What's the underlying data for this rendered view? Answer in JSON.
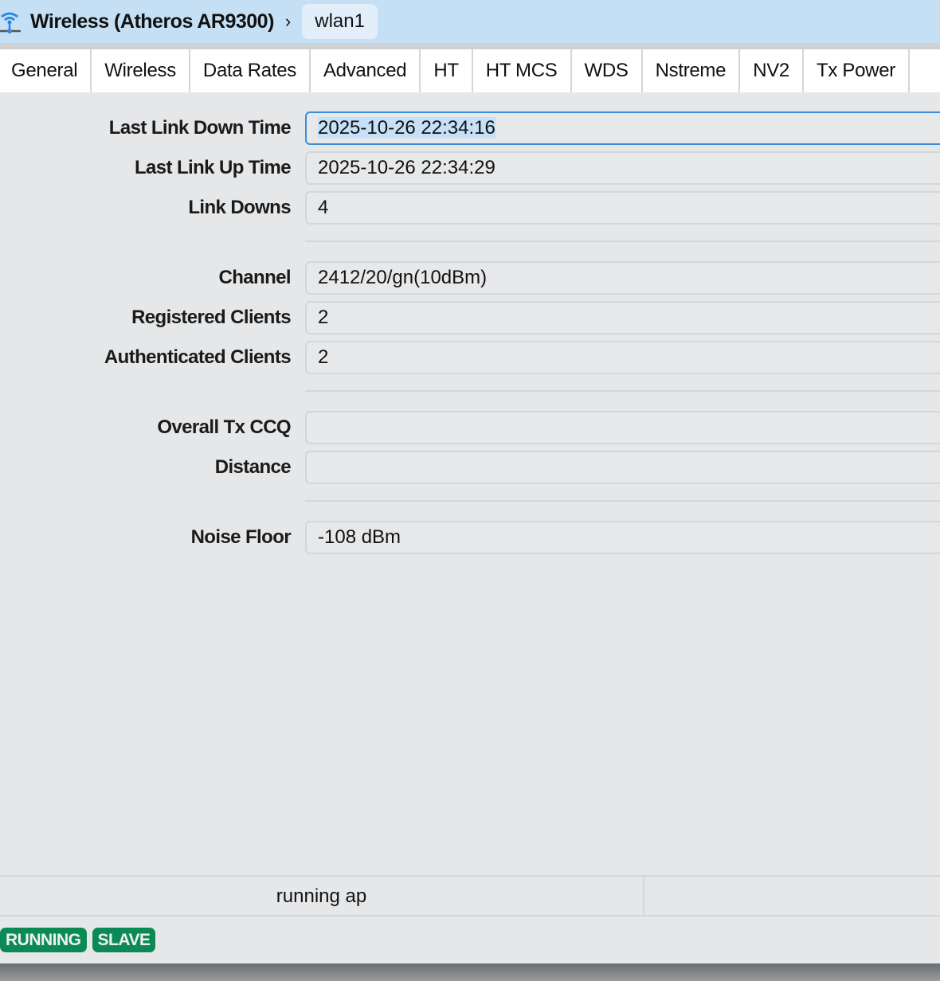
{
  "header": {
    "title": "Wireless (Atheros AR9300)",
    "separator": "›",
    "crumb": "wlan1"
  },
  "tabs": [
    {
      "label": "General"
    },
    {
      "label": "Wireless"
    },
    {
      "label": "Data Rates"
    },
    {
      "label": "Advanced"
    },
    {
      "label": "HT"
    },
    {
      "label": "HT MCS"
    },
    {
      "label": "WDS"
    },
    {
      "label": "Nstreme"
    },
    {
      "label": "NV2"
    },
    {
      "label": "Tx Power"
    }
  ],
  "fields": {
    "last_link_down": {
      "label": "Last Link Down Time",
      "value": "2025-10-26 22:34:16"
    },
    "last_link_up": {
      "label": "Last Link Up Time",
      "value": "2025-10-26 22:34:29"
    },
    "link_downs": {
      "label": "Link Downs",
      "value": "4"
    },
    "channel": {
      "label": "Channel",
      "value": "2412/20/gn(10dBm)"
    },
    "registered_clients": {
      "label": "Registered Clients",
      "value": "2"
    },
    "authenticated_clients": {
      "label": "Authenticated Clients",
      "value": "2"
    },
    "overall_tx_ccq": {
      "label": "Overall Tx CCQ",
      "value": ""
    },
    "distance": {
      "label": "Distance",
      "value": ""
    },
    "noise_floor": {
      "label": "Noise Floor",
      "value": "-108 dBm"
    }
  },
  "status": {
    "text": "running ap"
  },
  "badges": {
    "running": "RUNNING",
    "slave": "SLAVE"
  },
  "colors": {
    "accent": "#3a8fdc",
    "badge": "#0c8a56",
    "header": "#c5e0f5"
  }
}
